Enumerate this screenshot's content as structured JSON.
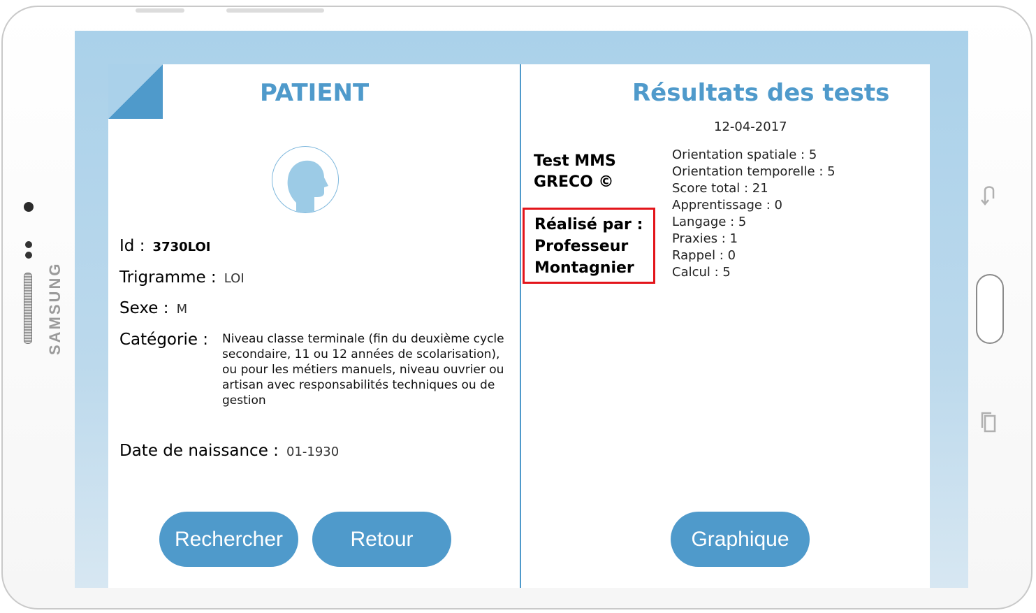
{
  "device": {
    "brand": "SAMSUNG"
  },
  "patient": {
    "title": "PATIENT",
    "id_label": "Id :",
    "id_value": "3730LOI",
    "trigramme_label": "Trigramme :",
    "trigramme_value": "LOI",
    "sexe_label": "Sexe :",
    "sexe_value": "M",
    "categorie_label": "Catégorie :",
    "categorie_value": "Niveau classe terminale (fin du deuxième cycle secondaire, 11 ou 12 années de scolarisation), ou pour les métiers manuels, niveau ouvrier ou artisan avec responsabilités techniques ou de gestion",
    "naissance_label": "Date de naissance :",
    "naissance_value": "01-1930"
  },
  "results": {
    "title": "Résultats des tests",
    "date": "12-04-2017",
    "test_line1": "Test MMS",
    "test_line2": "GRECO ©",
    "realise_line1": "Réalisé par :",
    "realise_line2": "Professeur",
    "realise_line3": "Montagnier",
    "scores": [
      "Orientation spatiale : 5",
      "Orientation temporelle : 5",
      "Score total : 21",
      "Apprentissage : 0",
      "Langage : 5",
      "Praxies : 1",
      "Rappel : 0",
      "Calcul : 5"
    ]
  },
  "buttons": {
    "search": "Rechercher",
    "back": "Retour",
    "graph": "Graphique"
  },
  "colors": {
    "accent": "#4f9acb",
    "highlight": "#e3151b",
    "background": "#aad1ea"
  },
  "icons": [
    "camera-icon",
    "back-nav-icon",
    "home-button",
    "recent-apps-icon",
    "avatar-icon"
  ]
}
